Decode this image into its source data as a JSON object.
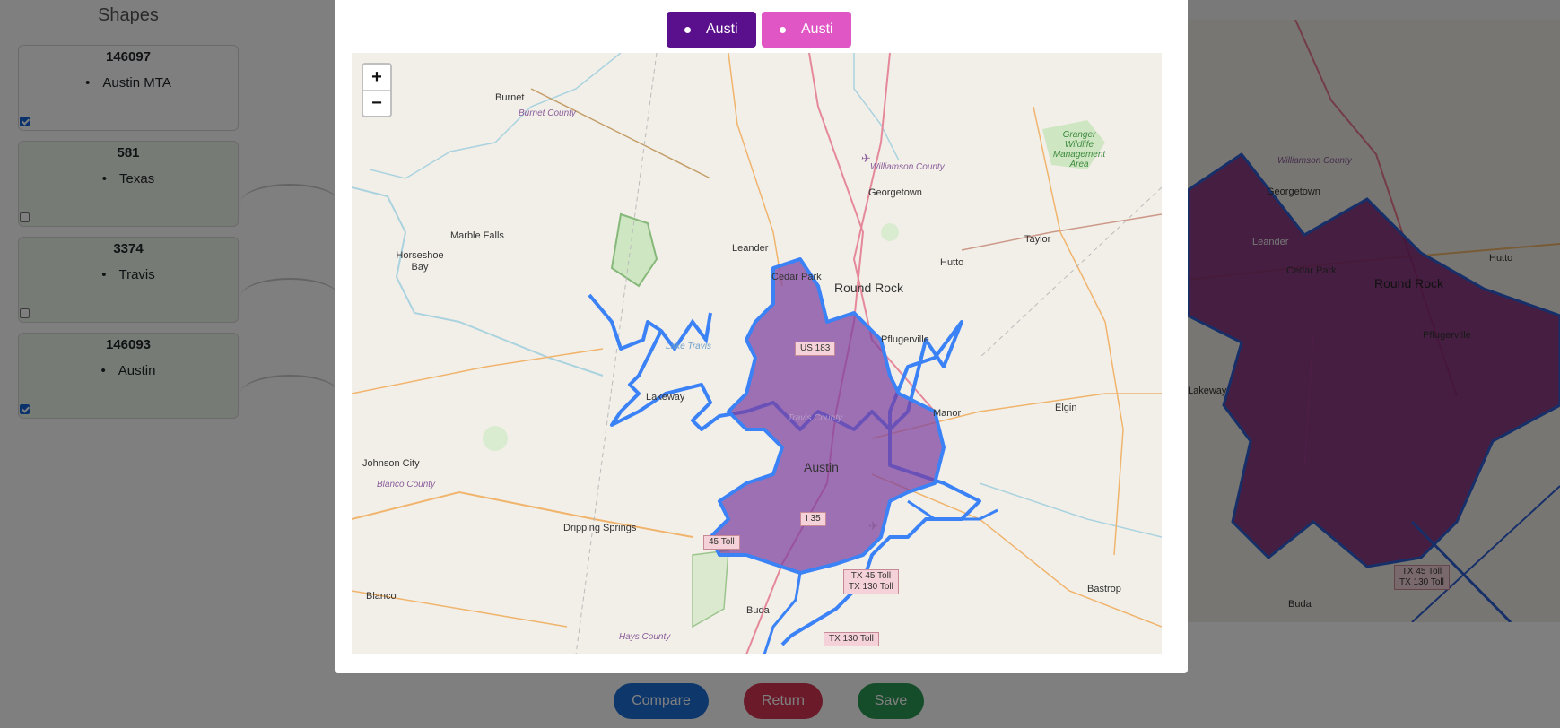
{
  "sidebar": {
    "title": "Shapes",
    "cards": [
      {
        "id": "146097",
        "item": "Austin MTA",
        "checked": true
      },
      {
        "id": "581",
        "item": "Texas",
        "checked": false
      },
      {
        "id": "3374",
        "item": "Travis",
        "checked": false
      },
      {
        "id": "146093",
        "item": "Austin",
        "checked": true
      }
    ]
  },
  "background_map": {
    "labels": {
      "georgetown": "Georgetown",
      "williamson": "Williamson County",
      "round_rock": "Round Rock",
      "cedar_park": "Cedar Park",
      "hutto": "Hutto",
      "pflugerville": "Pflugerville",
      "lakeway": "Lakeway",
      "leander": "Leander",
      "buda": "Buda",
      "tx45": "TX 45 Toll",
      "tx130": "TX 130 Toll"
    }
  },
  "actions": {
    "compare": "Compare",
    "return": "Return",
    "save": "Save"
  },
  "modal": {
    "legend": [
      {
        "label": "Austi",
        "color": "#5a0f8c"
      },
      {
        "label": "Austi",
        "color": "#e056c4"
      }
    ],
    "zoom": {
      "in": "+",
      "out": "−"
    },
    "map_labels": {
      "burnet": "Burnet",
      "burnet_county": "Burnet County",
      "marble_falls": "Marble Falls",
      "horseshoe_bay": "Horseshoe Bay",
      "leander": "Leander",
      "cedar_park": "Cedar Park",
      "georgetown": "Georgetown",
      "williamson_county": "Williamson County",
      "round_rock": "Round Rock",
      "hutto": "Hutto",
      "taylor": "Taylor",
      "pflugerville": "Pflugerville",
      "granger": "Granger Wildlife Management Area",
      "lakeway": "Lakeway",
      "lake_travis": "Lake Travis",
      "manor": "Manor",
      "elgin": "Elgin",
      "austin": "Austin",
      "johnson_city": "Johnson City",
      "blanco_county": "Blanco County",
      "dripping_springs": "Dripping Springs",
      "blanco": "Blanco",
      "buda": "Buda",
      "hays_county": "Hays County",
      "bastrop": "Bastrop",
      "travis_county": "Travis County"
    },
    "shields": {
      "us183": "US 183",
      "i35": "I 35",
      "toll45a": "TX 45 Toll",
      "toll130a": "TX 130 Toll",
      "toll130b": "TX 130 Toll",
      "toll_sw": "45 Toll"
    },
    "colors": {
      "boundary_blue": "#3b82f6",
      "fill_purple": "#7b3fa0"
    }
  }
}
